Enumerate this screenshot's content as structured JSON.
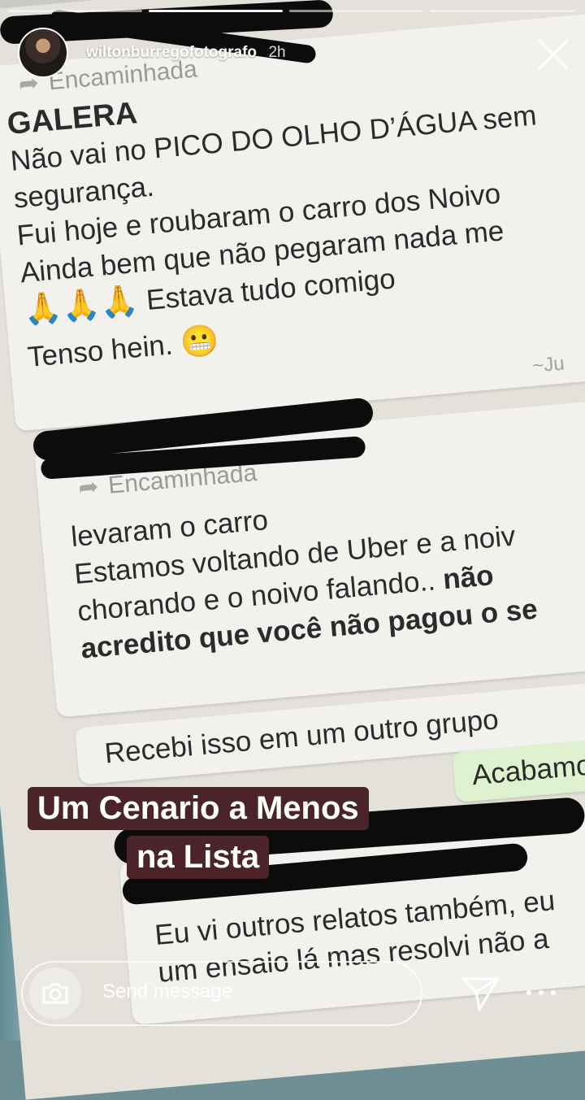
{
  "story": {
    "username": "wiltonburregofotografo",
    "time_ago": "2h",
    "caption_line1": "Um Cenario a Menos",
    "caption_line2": "na Lista",
    "progress_segments": 4,
    "active_segment": 2,
    "reply_placeholder": "Send message"
  },
  "chat": {
    "forwarded_label": "Encaminhada",
    "message1": {
      "title": "GALERA",
      "lines": [
        "Não vai no PICO DO OLHO D’ÁGUA sem",
        "segurança.",
        "Fui hoje e roubaram o carro dos Noivo",
        "Ainda bem que não pegaram nada me",
        "Estava tudo comigo",
        "Tenso hein."
      ],
      "emoji_prefix": "🙏🙏🙏",
      "emoji_suffix": "😬",
      "sender_hint": "~Ju"
    },
    "message2": {
      "lines": [
        "levaram o carro",
        "Estamos voltando de Uber e a noiv",
        "chorando e o noivo falando.."
      ],
      "bold_tail": "não",
      "bold_line": "acredito que você não pagou o se"
    },
    "message3": "Recebi isso em um outro grupo",
    "message4": "Acabamos d",
    "message5": {
      "lines": [
        "Eu vi outros relatos também, eu",
        "um ensaio lá mas resolvi não a"
      ]
    }
  },
  "colors": {
    "caption_bg": "#4a2428",
    "outgoing_bubble": "#dff2cf",
    "incoming_bubble": "#f2f1ed"
  },
  "icons": {
    "close": "close-icon",
    "camera": "camera-icon",
    "share": "paper-plane-icon",
    "more": "more-dots-icon",
    "forward": "forward-arrow-icon"
  }
}
